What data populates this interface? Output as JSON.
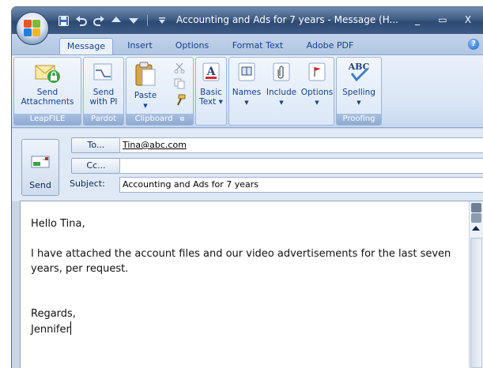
{
  "window": {
    "title": "Accounting and Ads for 7 years - Message (H...",
    "controls": {
      "minimize": "_",
      "maximize": "▭",
      "close": "X"
    }
  },
  "quick_access": [
    {
      "name": "save-icon",
      "glyph": "💾"
    },
    {
      "name": "undo-icon",
      "glyph": "↶"
    },
    {
      "name": "redo-icon",
      "glyph": "↷"
    },
    {
      "name": "previous-item-icon",
      "glyph": "▲"
    },
    {
      "name": "next-item-icon",
      "glyph": "▼"
    },
    {
      "name": "customize-qat-icon",
      "glyph": "▿"
    }
  ],
  "tabs": [
    "Message",
    "Insert",
    "Options",
    "Format Text",
    "Adobe PDF"
  ],
  "active_tab": "Message",
  "ribbon": {
    "groups": {
      "leapfile": "LeapFILE",
      "pardot": "Pardot",
      "clipboard": "Clipboard",
      "proofing": "Proofing"
    },
    "buttons": {
      "send_attachments": [
        "Send",
        "Attachments"
      ],
      "send_with_pi": [
        "Send",
        "with PI"
      ],
      "paste": "Paste",
      "basic_text": [
        "Basic",
        "Text"
      ],
      "names": "Names",
      "include": "Include",
      "options": "Options",
      "spelling": "Spelling"
    },
    "spelling_icon_text": "ABC"
  },
  "header": {
    "send_label": "Send",
    "to_button": "To...",
    "cc_button": "Cc...",
    "subject_label": "Subject:",
    "to_value": "Tina@abc.com",
    "cc_value": "",
    "subject_value": "Accounting and Ads for 7 years"
  },
  "body": {
    "greeting": "Hello Tina,",
    "line1": "I have attached the account files and our video advertisements for the last seven",
    "line2": "years, per request.",
    "closing": "Regards,",
    "signature": "Jennifer"
  },
  "colors": {
    "titlebar": "#3f5c84",
    "ribbon_text": "#15428b",
    "group_label": "#8ea9d1"
  }
}
